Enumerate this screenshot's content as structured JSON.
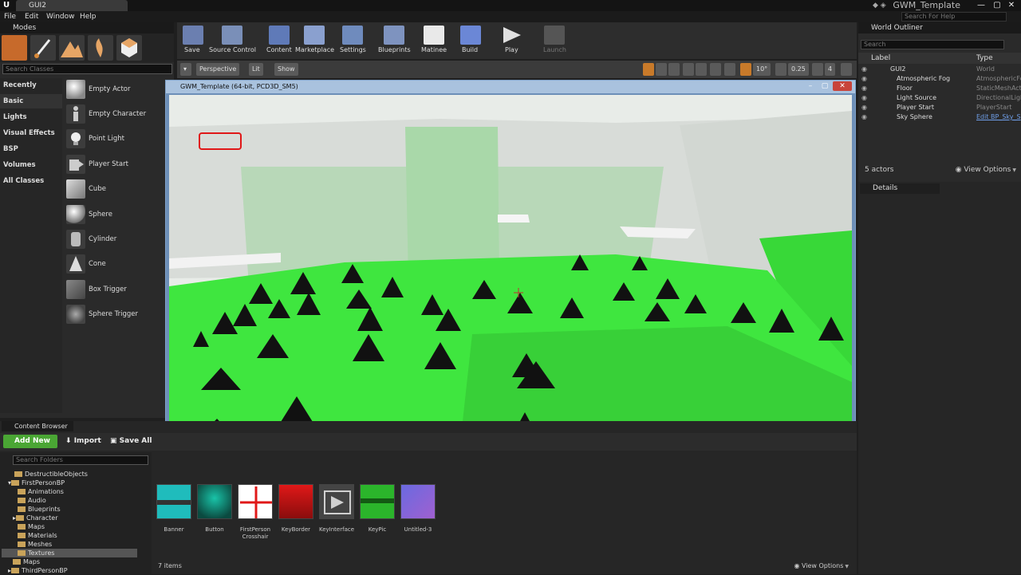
{
  "titlebar": {
    "tab": "GUI2",
    "project": "GWM_Template",
    "minimize": "—",
    "maximize": "▢",
    "close": "✕"
  },
  "menu": {
    "items": [
      "File",
      "Edit",
      "Window",
      "Help"
    ],
    "help_search_placeholder": "Search For Help"
  },
  "modes": {
    "title": "Modes",
    "search_placeholder": "Search Classes",
    "categories": [
      "Recently Placed",
      "Basic",
      "Lights",
      "Visual Effects",
      "BSP",
      "Volumes",
      "All Classes"
    ],
    "active_category": "Basic",
    "items": [
      "Empty Actor",
      "Empty Character",
      "Point Light",
      "Player Start",
      "Cube",
      "Sphere",
      "Cylinder",
      "Cone",
      "Box Trigger",
      "Sphere Trigger"
    ]
  },
  "toolbar": {
    "buttons": [
      "Save",
      "Source Control",
      "Content",
      "Marketplace",
      "Settings",
      "Blueprints",
      "Matinee",
      "Build",
      "Play",
      "Launch"
    ]
  },
  "viewport": {
    "perspective": "Perspective",
    "lit": "Lit",
    "show": "Show",
    "angle_snap": "10°",
    "scale_snap": "0.25",
    "camera_speed": "4"
  },
  "game_window": {
    "title": "GWM_Template (64-bit, PCD3D_SM5)"
  },
  "outliner": {
    "title": "World Outliner",
    "search_placeholder": "Search",
    "col_label": "Label",
    "col_type": "Type",
    "rows": [
      {
        "label": "GUI2",
        "type": "World"
      },
      {
        "label": "Atmospheric Fog",
        "type": "AtmosphericFog"
      },
      {
        "label": "Floor",
        "type": "StaticMeshActor"
      },
      {
        "label": "Light Source",
        "type": "DirectionalLight"
      },
      {
        "label": "Player Start",
        "type": "PlayerStart"
      },
      {
        "label": "Sky Sphere",
        "type": "Edit BP_Sky_S"
      }
    ],
    "actor_count": "5 actors",
    "view_options": "View Options"
  },
  "details": {
    "title": "Details"
  },
  "content_browser": {
    "title": "Content Browser",
    "add_new": "Add New",
    "import": "Import",
    "save_all": "Save All",
    "search_folders_placeholder": "Search Folders",
    "folders": [
      {
        "name": "DestructibleObjects",
        "depth": 1
      },
      {
        "name": "FirstPersonBP",
        "depth": 1
      },
      {
        "name": "Animations",
        "depth": 2
      },
      {
        "name": "Audio",
        "depth": 2
      },
      {
        "name": "Blueprints",
        "depth": 2
      },
      {
        "name": "Character",
        "depth": 2
      },
      {
        "name": "Maps",
        "depth": 2
      },
      {
        "name": "Materials",
        "depth": 2
      },
      {
        "name": "Meshes",
        "depth": 2
      },
      {
        "name": "Textures",
        "depth": 2
      },
      {
        "name": "Maps",
        "depth": 1
      },
      {
        "name": "ThirdPersonBP",
        "depth": 1
      }
    ],
    "selected_folder": "Textures",
    "assets": [
      {
        "label": "Banner",
        "color": "#1fbcbc"
      },
      {
        "label": "Button",
        "color": "#19c3a8"
      },
      {
        "label": "FirstPerson Crosshair",
        "color": "#ffffff"
      },
      {
        "label": "KeyBorder",
        "color": "#e01818"
      },
      {
        "label": "KeyInterface",
        "color": "#d0d0d0"
      },
      {
        "label": "KeyPic",
        "color": "#2bb52b"
      },
      {
        "label": "Untitled-3",
        "color": "#6a6ae0"
      }
    ],
    "item_count": "7 items",
    "view_options": "View Options"
  },
  "colors": {
    "accent_green": "#4aa634",
    "floor_green": "#3fe63f",
    "game_titlebar": "#a9c2de"
  }
}
